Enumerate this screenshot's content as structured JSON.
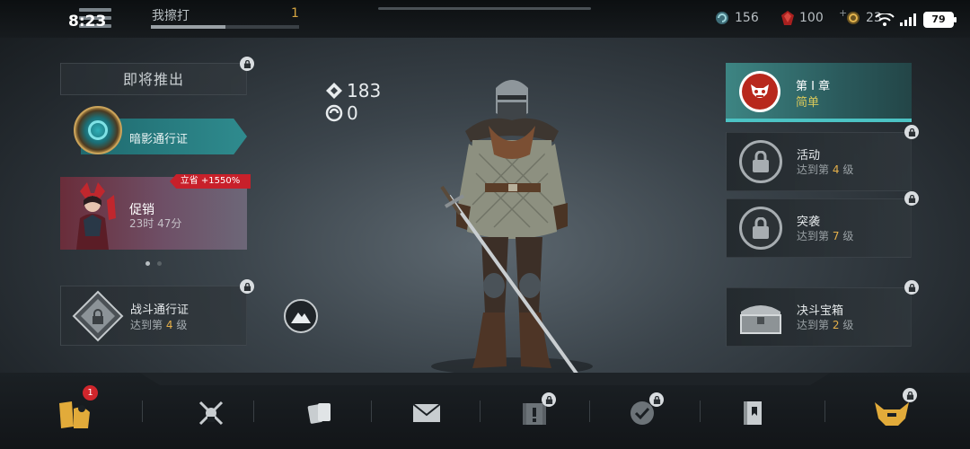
{
  "status_bar": {
    "time": "8:23",
    "battery": "79"
  },
  "player": {
    "name": "我擦打",
    "level": "1",
    "xp_fraction": 0.5
  },
  "currencies": [
    {
      "icon": "swirl-coin-icon",
      "value": "156"
    },
    {
      "icon": "red-gem-icon",
      "value": "100"
    },
    {
      "icon": "gold-ring-icon",
      "value": "23"
    }
  ],
  "left": {
    "coming_soon": "即将推出",
    "shadow_pass": "暗影通行证",
    "sale": {
      "ribbon": "立省 +1550%",
      "title": "促销",
      "time": "23时 47分"
    },
    "battle_pass": {
      "title": "战斗通行证",
      "sub_prefix": "达到第",
      "sub_level": "4",
      "sub_suffix": "级"
    }
  },
  "stats": {
    "power": "183",
    "swirl": "0"
  },
  "right": {
    "chapter": {
      "title": "第 I 章",
      "difficulty": "简单"
    },
    "event": {
      "title": "活动",
      "sub_prefix": "达到第",
      "sub_level": "4",
      "sub_suffix": "级"
    },
    "raid": {
      "title": "突袭",
      "sub_prefix": "达到第",
      "sub_level": "7",
      "sub_suffix": "级"
    },
    "duel_chest": {
      "title": "决斗宝箱",
      "sub_prefix": "达到第",
      "sub_level": "2",
      "sub_suffix": "级"
    }
  },
  "nav": {
    "badge_count": "1",
    "items": [
      "inventory-icon",
      "crossed-swords-icon",
      "cards-icon",
      "mail-icon",
      "quests-icon",
      "checkmark-icon",
      "journal-icon",
      "clan-helmet-icon"
    ]
  },
  "colors": {
    "accent_teal": "#2f8b8e",
    "gold": "#e5b04a",
    "sale_red": "#c8202a"
  }
}
